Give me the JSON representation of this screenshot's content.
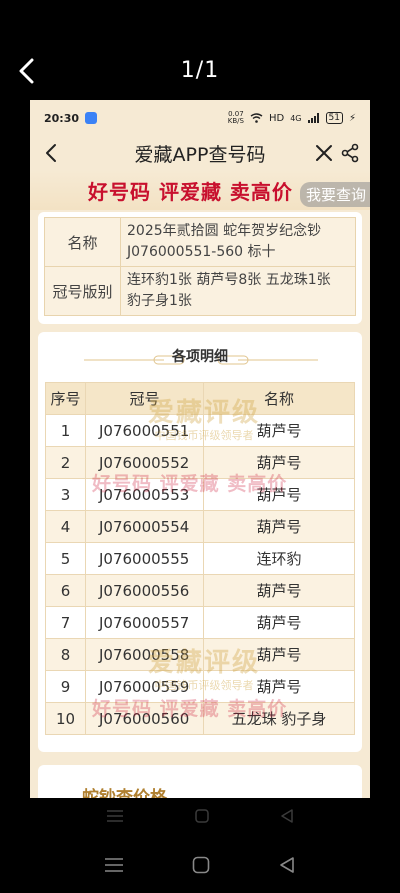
{
  "viewer": {
    "page_counter": "1/1"
  },
  "status_bar": {
    "time": "20:30",
    "speed_value": "0.07",
    "speed_unit": "KB/S",
    "hd": "HD",
    "network": "4G",
    "battery": "51"
  },
  "app": {
    "title": "爱藏APP查号码"
  },
  "banner": {
    "slogan": "好号码 评爱藏 卖高价",
    "query_button": "我要查询"
  },
  "info": {
    "rows": [
      {
        "label": "名称",
        "value": "2025年贰拾圆 蛇年贺岁纪念钞J076000551-560 标十"
      },
      {
        "label": "冠号版别",
        "value": "连环豹1张 葫芦号8张 五龙珠1张 豹子身1张"
      }
    ]
  },
  "detail": {
    "heading": "各项明细",
    "columns": [
      "序号",
      "冠号",
      "名称"
    ],
    "rows": [
      {
        "idx": "1",
        "code": "J076000551",
        "name": "葫芦号"
      },
      {
        "idx": "2",
        "code": "J076000552",
        "name": "葫芦号"
      },
      {
        "idx": "3",
        "code": "J076000553",
        "name": "葫芦号"
      },
      {
        "idx": "4",
        "code": "J076000554",
        "name": "葫芦号"
      },
      {
        "idx": "5",
        "code": "J076000555",
        "name": "连环豹"
      },
      {
        "idx": "6",
        "code": "J076000556",
        "name": "葫芦号"
      },
      {
        "idx": "7",
        "code": "J076000557",
        "name": "葫芦号"
      },
      {
        "idx": "8",
        "code": "J076000558",
        "name": "葫芦号"
      },
      {
        "idx": "9",
        "code": "J076000559",
        "name": "葫芦号"
      },
      {
        "idx": "10",
        "code": "J076000560",
        "name": "五龙珠 豹子身"
      }
    ]
  },
  "watermark": {
    "brand": "爱藏评级",
    "sub": "中国钱币评级领导者",
    "slogan": "好号码 评爱藏 卖高价"
  },
  "next_section": {
    "title": "蛇钞查价格"
  },
  "colors": {
    "accent_red": "#c8102e",
    "cream": "#f6ead4",
    "gold": "#cda03c"
  }
}
